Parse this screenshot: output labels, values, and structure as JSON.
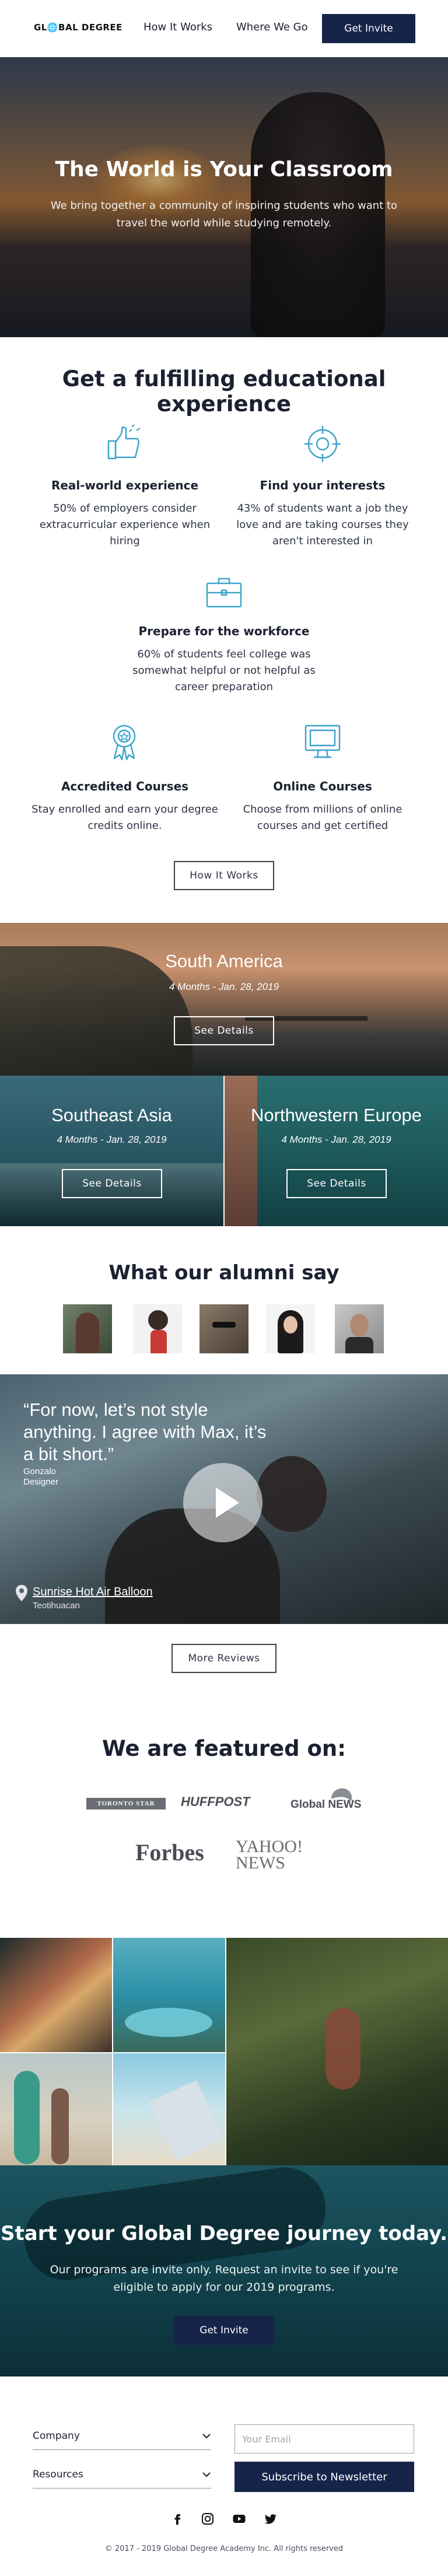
{
  "nav": {
    "logo": "GL🌐BAL DEGREE",
    "links": [
      "How It Works",
      "Where We Go"
    ],
    "invite": "Get Invite"
  },
  "hero": {
    "title": "The World is Your Classroom",
    "subtitle": "We bring together a community of inspiring students who want to travel the world while studying remotely."
  },
  "experience": {
    "title": "Get a fulfilling educational experience",
    "features": [
      {
        "icon": "thumbs-up-icon",
        "title": "Real-world experience",
        "desc": "50% of employers consider extracurricular experience when hiring"
      },
      {
        "icon": "target-icon",
        "title": "Find your interests",
        "desc": "43% of students want a job they love and are taking courses they aren't interested in"
      },
      {
        "icon": "briefcase-icon",
        "title": "Prepare for the workforce",
        "desc": "60% of students feel college was somewhat helpful or not helpful as career preparation"
      },
      {
        "icon": "award-icon",
        "title": "Accredited Courses",
        "desc": "Stay enrolled and earn your degree credits online."
      },
      {
        "icon": "monitor-icon",
        "title": "Online Courses",
        "desc": "Choose from millions of online courses and get certified"
      }
    ],
    "button": "How It Works"
  },
  "destinations": [
    {
      "name": "South America",
      "dates": "4 Months - Jan. 28, 2019",
      "button": "See Details"
    },
    {
      "name": "Southeast Asia",
      "dates": "4 Months - Jan. 28, 2019",
      "button": "See Details"
    },
    {
      "name": "Northwestern Europe",
      "dates": "4 Months - Jan. 28, 2019",
      "button": "See Details"
    }
  ],
  "alumni": {
    "title": "What our alumni say"
  },
  "video": {
    "quote": "“For now, let’s not style anything. I agree with Max, it’s a bit short.”",
    "author_name": "Gonzalo",
    "author_role": "Designer",
    "location": "Sunrise Hot Air Balloon",
    "location_sub": "Teotihuacan"
  },
  "reviews_button": "More Reviews",
  "featured": {
    "title": "We are featured on:",
    "logos": [
      "TORONTO STAR",
      "HUFFPOST",
      "Global NEWS",
      "Forbes",
      "YAHOO! NEWS"
    ]
  },
  "cta": {
    "title": "Start your Global Degree journey today.",
    "subtitle": "Our programs are invite only. Request an invite to see if you're eligible to apply for our 2019 programs.",
    "button": "Get Invite"
  },
  "footer": {
    "dropdowns": [
      "Company",
      "Resources"
    ],
    "email_placeholder": "Your Email",
    "subscribe": "Subscribe to Newsletter",
    "copyright": "© 2017 - 2019 Global Degree Academy Inc. All rights reserved"
  },
  "colors": {
    "navy": "#16244a",
    "icon_teal": "#3aa3c9",
    "text_dark": "#1b2130"
  }
}
